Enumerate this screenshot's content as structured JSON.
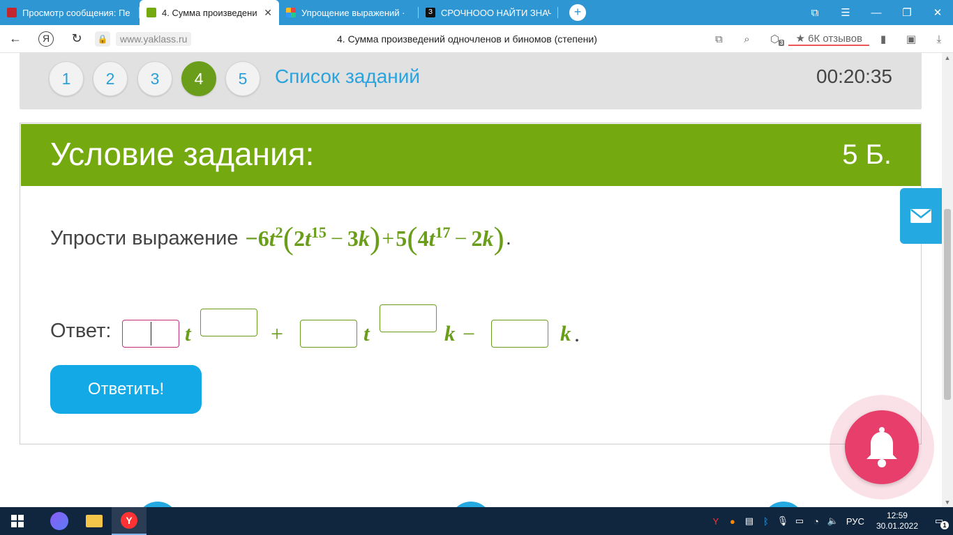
{
  "browser": {
    "tabs": [
      {
        "title": "Просмотр сообщения: Пе",
        "color": "#c2262e",
        "active": false
      },
      {
        "title": "4. Сумма произведени",
        "color": "#74aa0f",
        "active": true
      },
      {
        "title": "Упрощение выражений ·",
        "color": "#e4b21a",
        "active": false
      },
      {
        "title": "СРОЧНООО НАЙТИ ЗНАЧ",
        "color": "#111111",
        "active": false
      }
    ],
    "new_tab": "+",
    "domain": "www.yaklass.ru",
    "page_title": "4. Сумма произведений одночленов и биномов (степени)",
    "reviews": "★ 6К отзывов",
    "badge_count": "3"
  },
  "nav": {
    "questions": [
      "1",
      "2",
      "3",
      "4",
      "5"
    ],
    "active_index": 3,
    "task_list": "Список заданий",
    "timer": "00:20:35"
  },
  "task": {
    "header": "Условие задания:",
    "points": "5 Б.",
    "prompt": "Упрости выражение",
    "expr": {
      "c1": "−6",
      "v1": "t",
      "e1": "2",
      "a1": "2",
      "va1": "t",
      "ea1": "15",
      "op1": "−",
      "b1": "3",
      "vb1": "k",
      "plus": "+",
      "c2": "5",
      "a2": "4",
      "va2": "t",
      "ea2": "17",
      "op2": "−",
      "b2": "2",
      "vb2": "k",
      "end": "."
    },
    "answer_label": "Ответ:",
    "answer_vars": {
      "t1": "t",
      "plus": "+",
      "t2": "t",
      "k1": "k",
      "minus": "−",
      "k2": "k",
      "dot": "."
    },
    "inputs": [
      "",
      "",
      "",
      "",
      ""
    ],
    "submit": "Ответить!"
  },
  "taskbar": {
    "lang": "РУС",
    "time": "12:59",
    "date": "30.01.2022",
    "notifications": "1"
  },
  "colors": {
    "brand_green": "#74aa0f",
    "link_blue": "#2aa3de",
    "button_blue": "#13a8e6",
    "bell_pink": "#e83e6c"
  }
}
